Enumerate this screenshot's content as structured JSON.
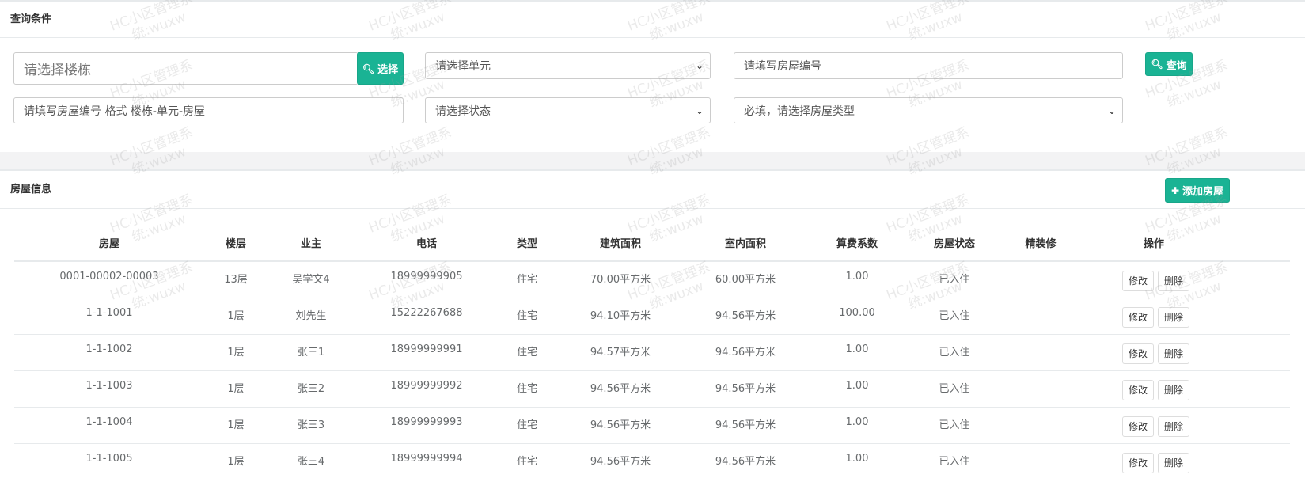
{
  "query": {
    "title": "查询条件",
    "building_placeholder": "请选择楼栋",
    "select_button": "选择",
    "unit_select": "请选择单元",
    "room_no_placeholder": "请填写房屋编号",
    "search_button": "查询",
    "room_format_placeholder": "请填写房屋编号 格式 楼栋-单元-房屋",
    "status_select": "请选择状态",
    "type_select": "必填，请选择房屋类型"
  },
  "rooms": {
    "title": "房屋信息",
    "add_button": "添加房屋",
    "columns": [
      "房屋",
      "楼层",
      "业主",
      "电话",
      "类型",
      "建筑面积",
      "室内面积",
      "算费系数",
      "房屋状态",
      "精装修",
      "操作"
    ],
    "rows": [
      [
        "0001-00002-00003",
        "13层",
        "吴学文4",
        "18999999905",
        "住宅",
        "70.00平方米",
        "60.00平方米",
        "1.00",
        "已入住",
        ""
      ],
      [
        "1-1-1001",
        "1层",
        "刘先生",
        "15222267688",
        "住宅",
        "94.10平方米",
        "94.56平方米",
        "100.00",
        "已入住",
        ""
      ],
      [
        "1-1-1002",
        "1层",
        "张三1",
        "18999999991",
        "住宅",
        "94.57平方米",
        "94.56平方米",
        "1.00",
        "已入住",
        ""
      ],
      [
        "1-1-1003",
        "1层",
        "张三2",
        "18999999992",
        "住宅",
        "94.56平方米",
        "94.56平方米",
        "1.00",
        "已入住",
        ""
      ],
      [
        "1-1-1004",
        "1层",
        "张三3",
        "18999999993",
        "住宅",
        "94.56平方米",
        "94.56平方米",
        "1.00",
        "已入住",
        ""
      ],
      [
        "1-1-1005",
        "1层",
        "张三4",
        "18999999994",
        "住宅",
        "94.56平方米",
        "94.56平方米",
        "1.00",
        "已入住",
        ""
      ]
    ],
    "edit_label": "修改",
    "delete_label": "删除"
  },
  "watermark": {
    "line1": "HC小区管理系",
    "line2": "统:wuxw"
  },
  "colors": {
    "accent": "#1ab394",
    "page_bg": "#f3f3f4"
  }
}
